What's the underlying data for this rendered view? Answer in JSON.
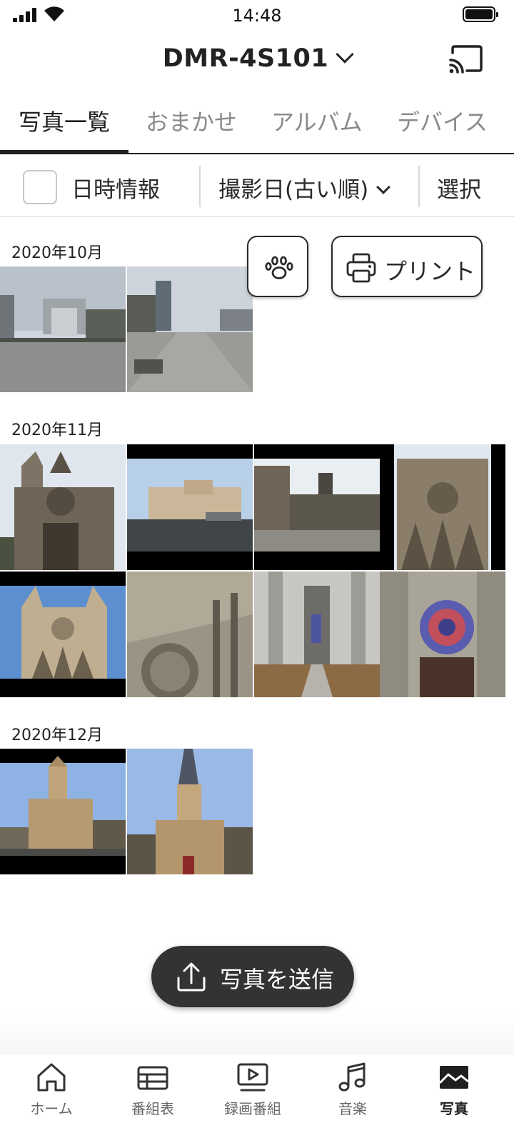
{
  "status_bar": {
    "time": "14:48"
  },
  "header": {
    "device_name": "DMR-4S101"
  },
  "tabs": [
    {
      "label": "写真一覧",
      "active": true
    },
    {
      "label": "おまかせ",
      "active": false
    },
    {
      "label": "アルバム",
      "active": false
    },
    {
      "label": "デバイス",
      "active": false
    }
  ],
  "toolbar": {
    "datetime_label": "日時情報",
    "datetime_checked": false,
    "sort_label": "撮影日(古い順)",
    "select_label": "選択"
  },
  "floating": {
    "print_label": "プリント"
  },
  "sections": [
    {
      "date": "2020年10月",
      "photo_count": 2
    },
    {
      "date": "2020年11月",
      "photo_count": 8
    },
    {
      "date": "2020年12月",
      "photo_count": 2
    }
  ],
  "send_button": {
    "label": "写真を送信"
  },
  "bottom_nav": [
    {
      "label": "ホーム",
      "icon": "home-icon",
      "active": false
    },
    {
      "label": "番組表",
      "icon": "tv-guide-icon",
      "active": false
    },
    {
      "label": "録画番組",
      "icon": "recorded-icon",
      "active": false
    },
    {
      "label": "音楽",
      "icon": "music-icon",
      "active": false
    },
    {
      "label": "写真",
      "icon": "photo-icon",
      "active": true
    }
  ]
}
